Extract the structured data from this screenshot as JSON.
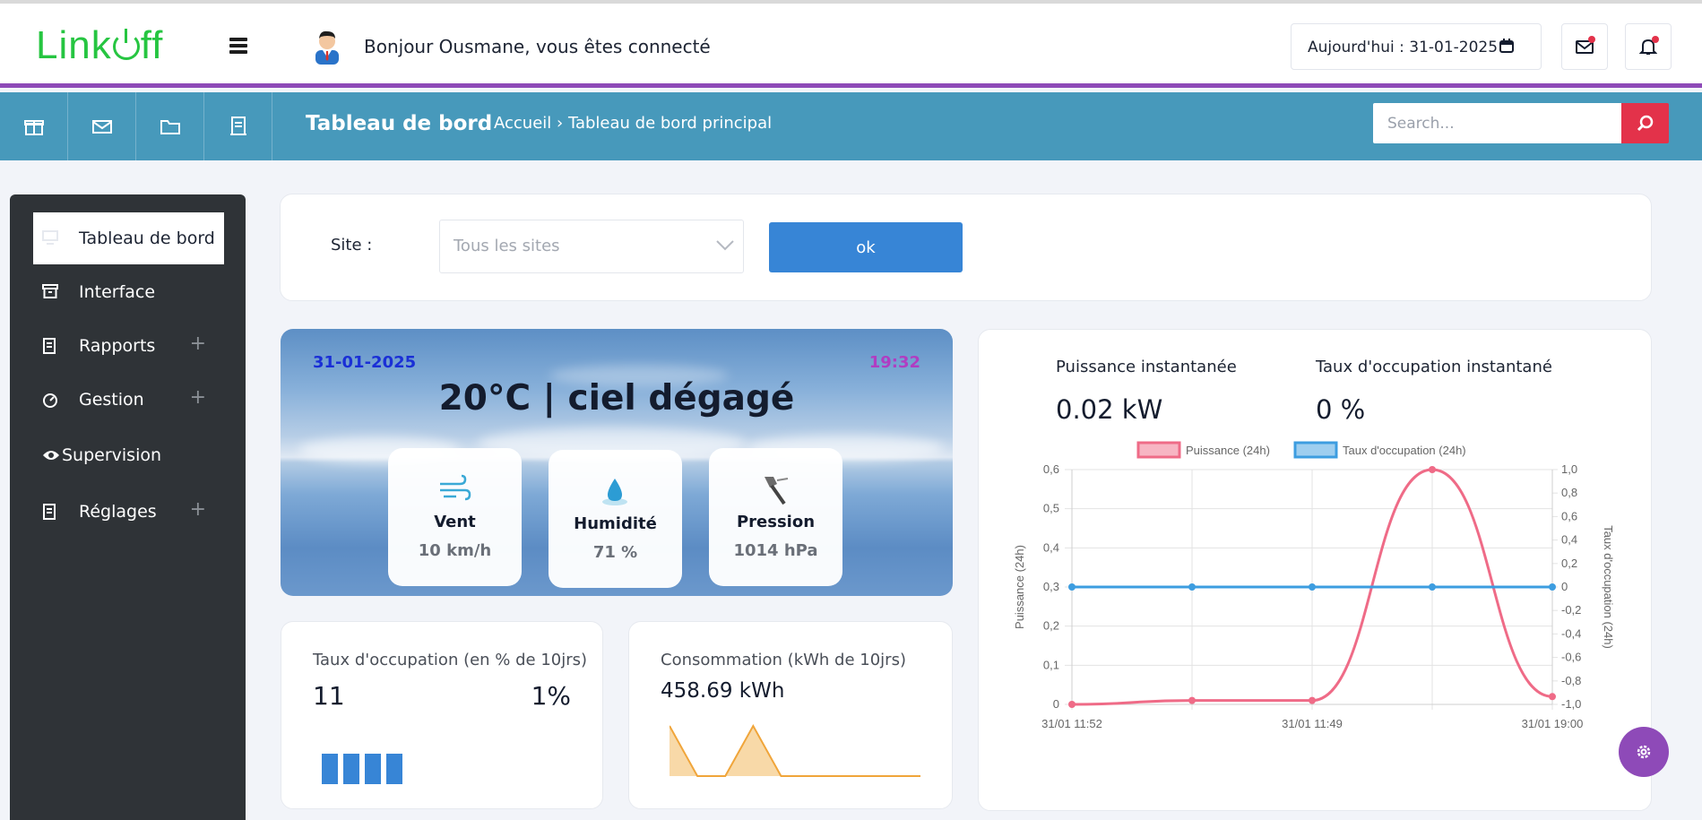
{
  "header": {
    "logo_text_left": "Link",
    "logo_text_right": "ff",
    "greeting": "Bonjour Ousmane, vous êtes connecté",
    "date_label": "Aujourd'hui : 31-01-2025"
  },
  "subbar": {
    "title": "Tableau de bord",
    "breadcrumb_home": "Accueil",
    "breadcrumb_sep": "›",
    "breadcrumb_current": "Tableau de bord principal",
    "search_placeholder": "Search..."
  },
  "sidebar": {
    "items": [
      {
        "label": "Tableau de bord"
      },
      {
        "label": "Interface"
      },
      {
        "label": "Rapports",
        "expand": "+"
      },
      {
        "label": "Gestion",
        "expand": "+"
      },
      {
        "label": "Supervision"
      },
      {
        "label": "Réglages",
        "expand": "+"
      }
    ]
  },
  "filter": {
    "site_label": "Site :",
    "site_selected": "Tous les sites",
    "ok_label": "ok"
  },
  "weather": {
    "date": "31-01-2025",
    "time": "19:32",
    "summary": "20°C | ciel dégagé",
    "wind_label": "Vent",
    "wind_value": "10 km/h",
    "humidity_label": "Humidité",
    "humidity_value": "71 %",
    "pressure_label": "Pression",
    "pressure_value": "1014 hPa"
  },
  "occupancy": {
    "title": "Taux d'occupation (en % de 10jrs)",
    "count": "11",
    "percent": "1%",
    "bars": [
      1,
      1,
      1,
      1
    ]
  },
  "consumption": {
    "title": "Consommation (kWh de 10jrs)",
    "value": "458.69 kWh",
    "spark": [
      5,
      0,
      0,
      5,
      0,
      0,
      0,
      0,
      0,
      0
    ]
  },
  "kpis": {
    "power_label": "Puissance instantanée",
    "power_value": "0.02 kW",
    "occ_label": "Taux d'occupation instantané",
    "occ_value": "0 %"
  },
  "chart_data": {
    "type": "line",
    "x": [
      "31/01 11:52",
      "",
      "31/01 11:49",
      "",
      "31/01 19:00"
    ],
    "x_tick_labels": [
      "31/01 11:52",
      "31/01 11:49",
      "31/01 19:00"
    ],
    "series": [
      {
        "name": "Puissance (24h)",
        "axis": "left",
        "color": "#ef6b87",
        "values": [
          0,
          0.01,
          0.01,
          0.6,
          0.02
        ]
      },
      {
        "name": "Taux d'occupation (24h)",
        "axis": "right",
        "color": "#3d9de0",
        "values": [
          0,
          0,
          0,
          0,
          0
        ]
      }
    ],
    "ylabel": "Puissance (24h)",
    "y2label": "Taux d'occupation (24h)",
    "ylim": [
      0,
      0.6
    ],
    "y_ticks": [
      "0",
      "0,1",
      "0,2",
      "0,3",
      "0,4",
      "0,5",
      "0,6"
    ],
    "y2lim": [
      -1.0,
      1.0
    ],
    "y2_ticks": [
      "-1,0",
      "-0,8",
      "-0,6",
      "-0,4",
      "-0,2",
      "0",
      "0,2",
      "0,4",
      "0,6",
      "0,8",
      "1,0"
    ],
    "grid": true,
    "legend": "top"
  }
}
